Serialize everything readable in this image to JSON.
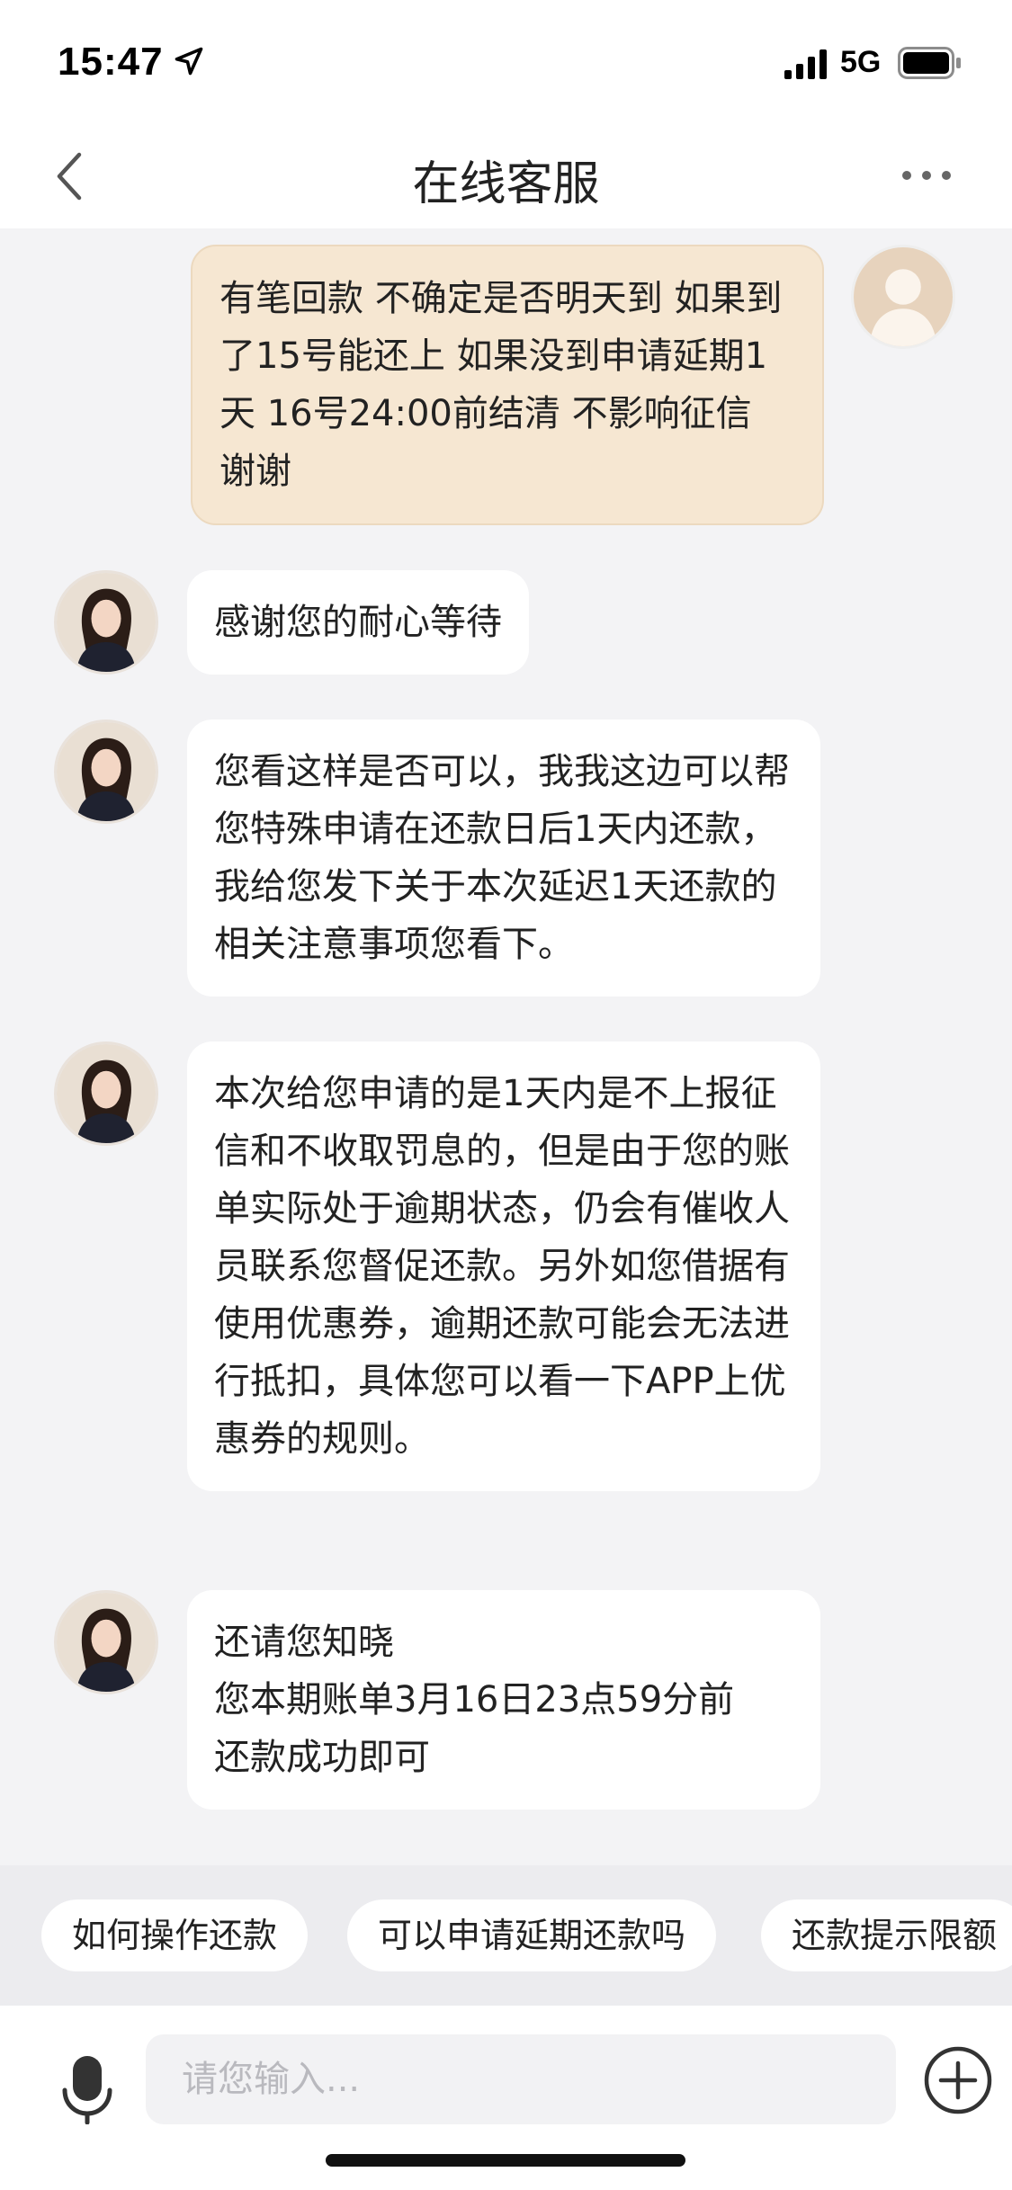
{
  "status_bar": {
    "time": "15:47",
    "network": "5G",
    "icons": [
      "location-arrow-icon",
      "signal-bars-icon",
      "battery-icon"
    ]
  },
  "nav": {
    "title": "在线客服",
    "icons": [
      "back-chevron-icon",
      "more-dots-icon"
    ]
  },
  "messages": [
    {
      "sender": "user",
      "text": "有笔回款 不确定是否明天到 如果到了15号能还上 如果没到申请延期1天 16号24:00前结清 不影响征信 谢谢"
    },
    {
      "sender": "agent",
      "text": "感谢您的耐心等待"
    },
    {
      "sender": "agent",
      "text": "您看这样是否可以，我我这边可以帮您特殊申请在还款日后1天内还款，我给您发下关于本次延迟1天还款的相关注意事项您看下。"
    },
    {
      "sender": "agent",
      "text": "本次给您申请的是1天内是不上报征信和不收取罚息的，但是由于您的账单实际处于逾期状态，仍会有催收人员联系您督促还款。另外如您借据有使用优惠券，逾期还款可能会无法进行抵扣，具体您可以看一下APP上优惠券的规则。"
    },
    {
      "sender": "agent",
      "text_lines": [
        "还请您知晓",
        "您本期账单3月16日23点59分前",
        "还款成功即可"
      ]
    }
  ],
  "quick_replies": [
    "如何操作还款",
    "可以申请延期还款吗",
    "还款提示限额"
  ],
  "input": {
    "placeholder": "请您输入...",
    "value": "",
    "icons": [
      "microphone-icon",
      "plus-circle-icon"
    ]
  },
  "colors": {
    "user_bubble": "#f6e7d2",
    "agent_bubble": "#ffffff",
    "chat_background": "#f3f3f5"
  }
}
